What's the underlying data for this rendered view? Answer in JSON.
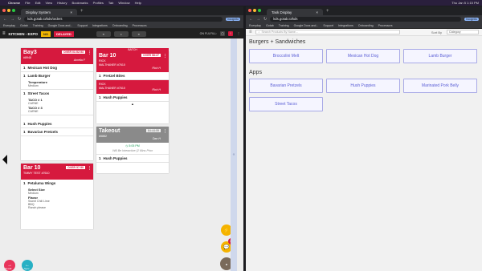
{
  "menubar": {
    "items": [
      "Chrome",
      "File",
      "Edit",
      "View",
      "History",
      "Bookmarks",
      "Profiles",
      "Tab",
      "Window",
      "Help"
    ],
    "clock": "Thu Jan 5 1:15 PM"
  },
  "left_window": {
    "tab_title": "Display System",
    "url": "kds.gotab.io/kds/orders",
    "profile": "Incognito",
    "bookmarks": [
      "Everyday",
      "Gotab",
      "Training",
      "Google Docs and...",
      "Support",
      "Integrations",
      "Onboarding",
      "Processors"
    ],
    "app": {
      "title": "KITCHEN - EXPO",
      "chip_no": "NO",
      "chip_delayed": "DELAYED",
      "nav_prev": "«",
      "nav_center": "•",
      "nav_next": "»",
      "fullfill": "ON FULFILL:",
      "splitter_glyph": "«"
    },
    "cards": [
      {
        "title": "Bay3",
        "over": "OVER 01:52:53",
        "sub": "#8948",
        "who": "Amelia F",
        "head_color": "#d6193e",
        "items": [
          {
            "q": "1",
            "name": "Mexican Hot Dog",
            "mods": []
          },
          {
            "q": "1",
            "name": "Lamb Burger",
            "mods": [
              {
                "label": "Temperature",
                "value": "Medium"
              }
            ]
          },
          {
            "q": "1",
            "name": "Street Tacos",
            "mods": [
              {
                "label": "TACO # 1",
                "value": "CARNE"
              },
              {
                "label": "TACO # 3",
                "value": "CARNE"
              }
            ]
          },
          {
            "q": "1",
            "name": "Hush Puppies",
            "mods": []
          },
          {
            "q": "1",
            "name": "Bavarian Pretzels",
            "mods": []
          }
        ]
      },
      {
        "title": "Bar 10",
        "over": "OVER 58:27",
        "sub": "RICK",
        "sub2": "MALTHANER #7610",
        "who": "Rick H",
        "head_color": "#d6193e",
        "items": [
          {
            "q": "1",
            "name": "Pretzel Bites",
            "mods": []
          }
        ],
        "head2": {
          "title": "RICK",
          "sub": "MALTHANER #7610",
          "who": "Rick H"
        },
        "items2": [
          {
            "q": "1",
            "name": "Hush Puppies",
            "mods": []
          }
        ]
      },
      {
        "title": "Takeout",
        "over": "$4:44:55",
        "sub": "#5882",
        "who": "Dan H",
        "head_color": "#8a8a8a",
        "ready": "5:05 PM",
        "note": "Will Be Interactive (2 Mins Prior",
        "items": [
          {
            "q": "1",
            "name": "Hush Puppies",
            "mods": []
          }
        ]
      },
      {
        "title": "Bar 10",
        "over": "OVER 57:59",
        "sub": "TIMMY TEST #7610",
        "who": "",
        "head_color": "#d6193e",
        "items": [
          {
            "q": "1",
            "name": "Petaluma Wings",
            "mods": [
              {
                "label": "Select Size",
                "value": "Medium"
              },
              {
                "label": "Flavor",
                "value": "Sweet Chili Lime"
              },
              {
                "label": "",
                "value": "BBQ"
              },
              {
                "label": "",
                "value": "Ranch please"
              }
            ]
          }
        ]
      }
    ],
    "partial_header": "BATCH",
    "fab_recall": "Recall",
    "fab_sync": "Sync",
    "notif_count": "14"
  },
  "right_window": {
    "tab_title": "Task Display",
    "url": "kds.gotab.io/kds",
    "profile": "Incognito",
    "bookmarks": [
      "Everyday",
      "Gotab",
      "Training",
      "Google Docs and...",
      "Support",
      "Integrations",
      "Onboarding",
      "Processors"
    ],
    "search_placeholder": "Search Products By Name...",
    "sort_label": "Sort By",
    "sort_value": "Category",
    "sections": [
      {
        "title": "Burgers + Sandwiches",
        "products": [
          "Broccolini Melt",
          "Mexican Hot Dog",
          "Lamb Burger"
        ]
      },
      {
        "title": "Apps",
        "products": [
          "Bavarian Pretzels",
          "Hush Puppies",
          "Marinated Pork Belly",
          "Street Tacos"
        ]
      }
    ]
  },
  "colors": {
    "brand_red": "#d6193e",
    "accent_yellow": "#f2b600",
    "product_border": "#a8a9e6",
    "product_text": "#5b5fd6"
  }
}
